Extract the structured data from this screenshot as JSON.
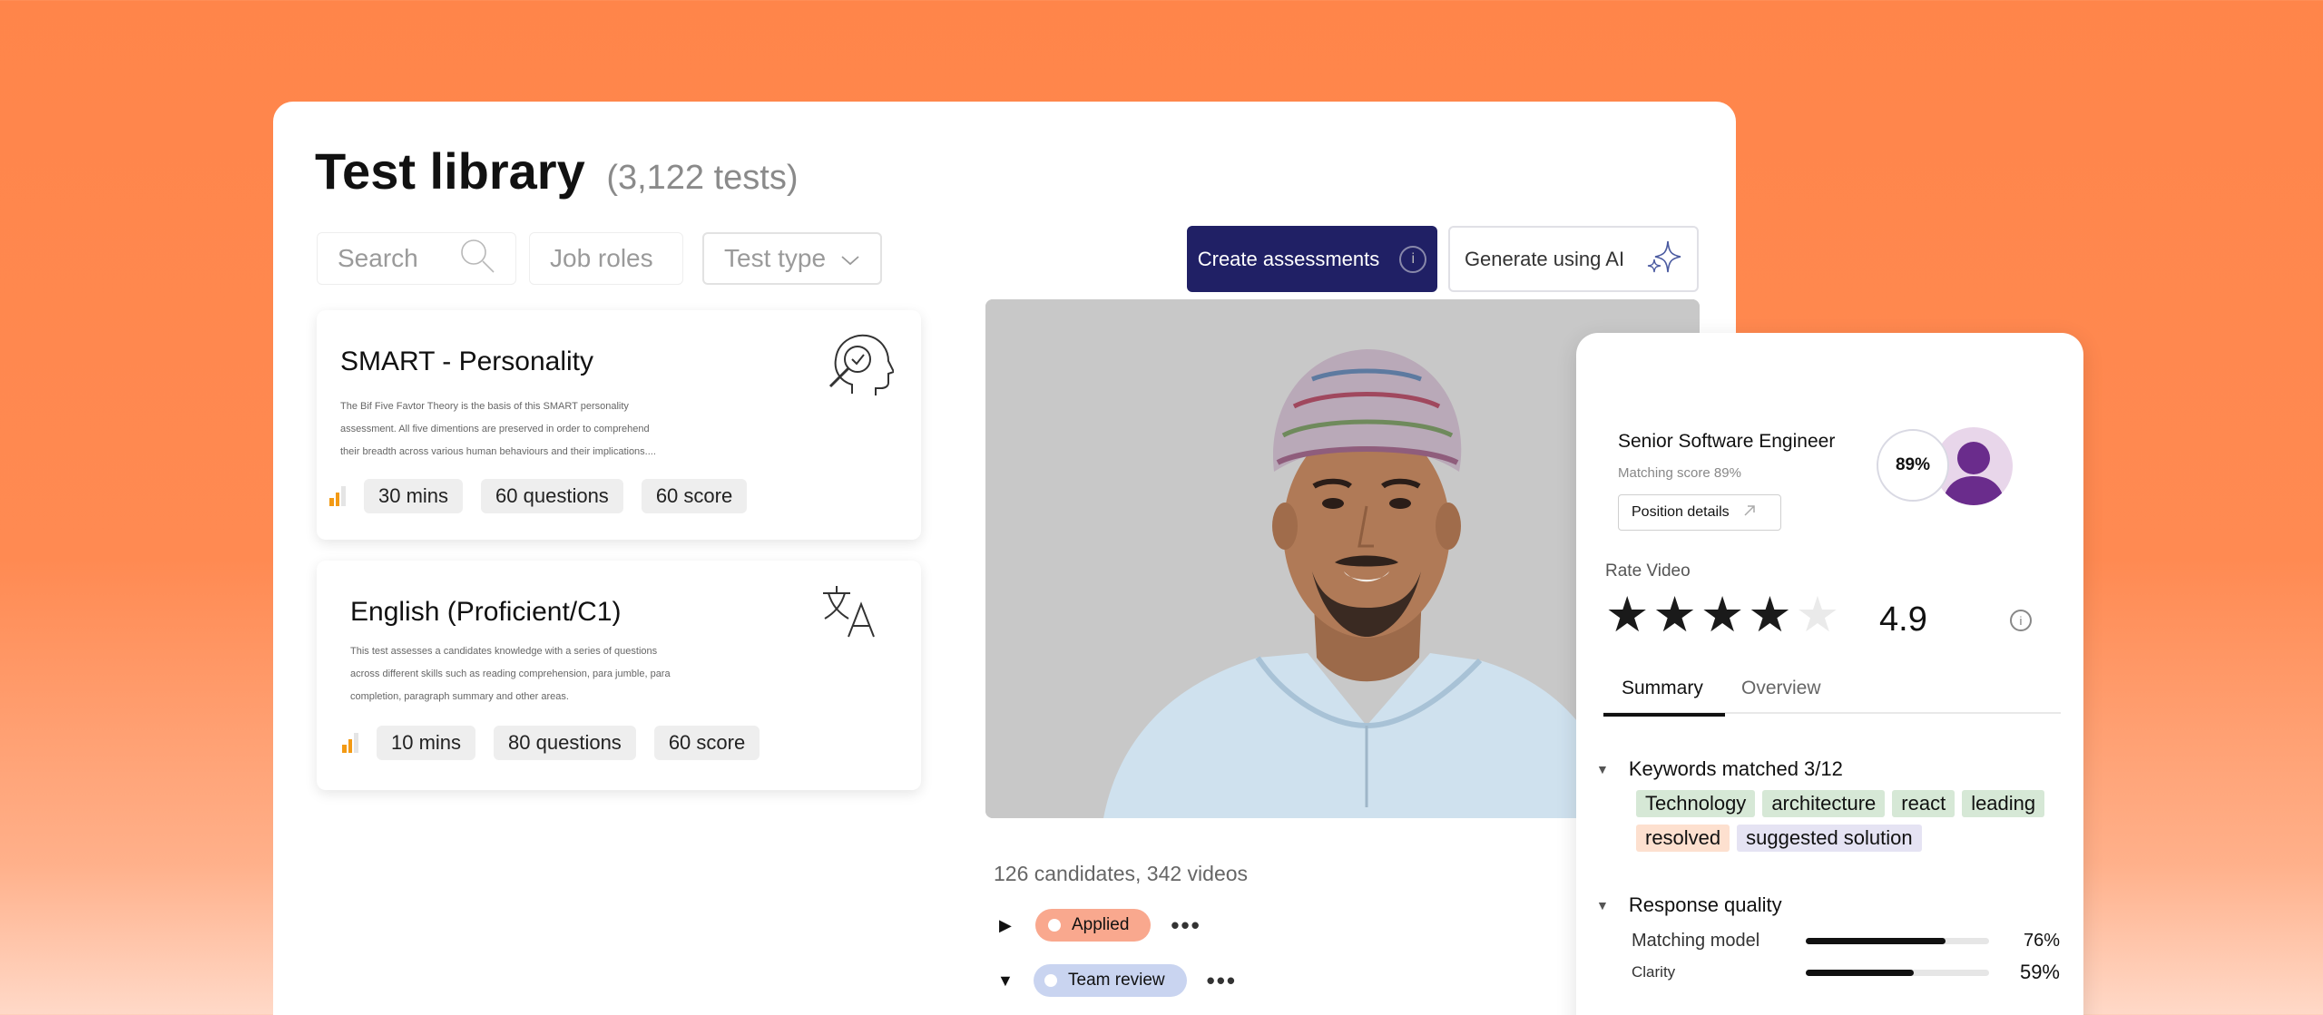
{
  "library": {
    "title": "Test library",
    "count": "(3,122 tests)",
    "filters": {
      "search_placeholder": "Search",
      "job_roles": "Job roles",
      "test_type": "Test type"
    },
    "create_button": "Create assessments",
    "ai_button": "Generate using AI",
    "cards": [
      {
        "title": "SMART - Personality",
        "desc_lines": [
          "The Bif Five Favtor Theory is the basis of this SMART personality",
          "assessment. All five dimentions are preserved in order to comprehend",
          "their breadth across various human behaviours and their implications...."
        ],
        "duration": "30 mins",
        "questions": "60 questions",
        "score": "60 score",
        "level": 2,
        "icon": "head-search-icon"
      },
      {
        "title": "English (Proficient/C1)",
        "desc_lines": [
          "This test assesses a candidates knowledge with a series of questions",
          "across different skills such as reading comprehension, para jumble, para",
          "completion, paragraph summary and other areas."
        ],
        "duration": "10 mins",
        "questions": "80 questions",
        "score": "60 score",
        "level": 2,
        "icon": "translate-icon"
      }
    ]
  },
  "video": {
    "stats": "126 candidates, 342 videos",
    "statuses": [
      {
        "label": "Applied",
        "color": "#f9a88e",
        "expanded": false
      },
      {
        "label": "Team review",
        "color": "#c9d4f0",
        "expanded": true
      }
    ]
  },
  "panel": {
    "role": "Senior Software Engineer",
    "matching": "Matching score 89%",
    "position_details": "Position details",
    "score": "89%",
    "rate_label": "Rate Video",
    "stars_filled": 4,
    "stars_total": 5,
    "rating": "4.9",
    "tabs": [
      "Summary",
      "Overview"
    ],
    "keywords_title": "Keywords matched 3/12",
    "keywords": [
      {
        "text": "Technology",
        "tone": "green"
      },
      {
        "text": "architecture",
        "tone": "green"
      },
      {
        "text": "react",
        "tone": "green"
      },
      {
        "text": "leading",
        "tone": "green"
      },
      {
        "text": "resolved",
        "tone": "orange"
      },
      {
        "text": "suggested solution",
        "tone": "purple"
      }
    ],
    "quality_title": "Response quality",
    "metrics": [
      {
        "label": "Matching model",
        "value": "76%",
        "fraction": 0.76
      },
      {
        "label": "Clarity",
        "value": "59%",
        "fraction": 0.59
      }
    ]
  },
  "colors": {
    "background": "#ff854a",
    "primary": "#202065",
    "level": "#f39a14"
  }
}
